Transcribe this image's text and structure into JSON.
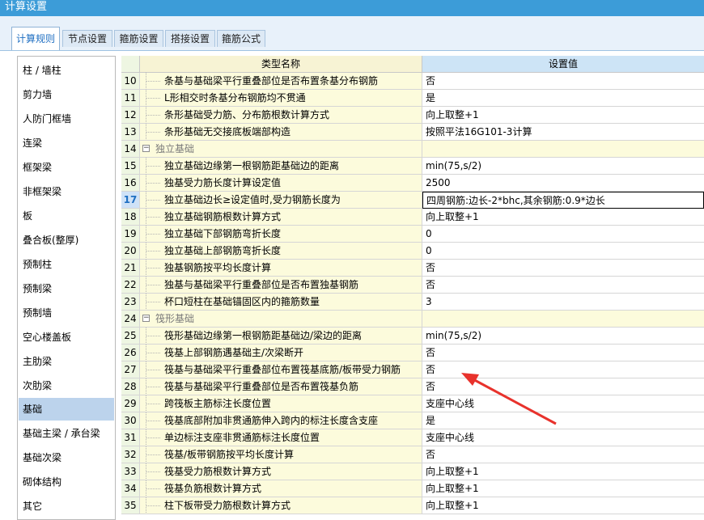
{
  "window": {
    "title": "计算设置"
  },
  "tabs": [
    "计算规则",
    "节点设置",
    "箍筋设置",
    "搭接设置",
    "箍筋公式"
  ],
  "sidebar": {
    "items": [
      "柱 / 墙柱",
      "剪力墙",
      "人防门框墙",
      "连梁",
      "框架梁",
      "非框架梁",
      "板",
      "叠合板(整厚)",
      "预制柱",
      "预制梁",
      "预制墙",
      "空心楼盖板",
      "主肋梁",
      "次肋梁",
      "基础",
      "基础主梁 / 承台梁",
      "基础次梁",
      "砌体结构",
      "其它"
    ],
    "selected": "基础"
  },
  "table": {
    "headers": {
      "name": "类型名称",
      "value": "设置值"
    },
    "rows": [
      {
        "num": "10",
        "name": "条基与基础梁平行重叠部位是否布置条基分布钢筋",
        "value": "否"
      },
      {
        "num": "11",
        "name": "L形相交时条基分布钢筋均不贯通",
        "value": "是"
      },
      {
        "num": "12",
        "name": "条形基础受力筋、分布筋根数计算方式",
        "value": "向上取整+1"
      },
      {
        "num": "13",
        "name": "条形基础无交接底板端部构造",
        "value": "按照平法16G101-3计算"
      },
      {
        "num": "14",
        "name": "独立基础",
        "value": "",
        "group": true
      },
      {
        "num": "15",
        "name": "独立基础边缘第一根钢筋距基础边的距离",
        "value": "min(75,s/2)"
      },
      {
        "num": "16",
        "name": "独基受力筋长度计算设定值",
        "value": "2500"
      },
      {
        "num": "17",
        "name": "独立基础边长≥设定值时,受力钢筋长度为",
        "value": "四周钢筋:边长-2*bhc,其余钢筋:0.9*边长",
        "active": true
      },
      {
        "num": "18",
        "name": "独立基础钢筋根数计算方式",
        "value": "向上取整+1"
      },
      {
        "num": "19",
        "name": "独立基础下部钢筋弯折长度",
        "value": "0"
      },
      {
        "num": "20",
        "name": "独立基础上部钢筋弯折长度",
        "value": "0"
      },
      {
        "num": "21",
        "name": "独基钢筋按平均长度计算",
        "value": "否"
      },
      {
        "num": "22",
        "name": "独基与基础梁平行重叠部位是否布置独基钢筋",
        "value": "否"
      },
      {
        "num": "23",
        "name": "杯口短柱在基础锚固区内的箍筋数量",
        "value": "3"
      },
      {
        "num": "24",
        "name": "筏形基础",
        "value": "",
        "group": true
      },
      {
        "num": "25",
        "name": "筏形基础边缘第一根钢筋距基础边/梁边的距离",
        "value": "min(75,s/2)"
      },
      {
        "num": "26",
        "name": "筏基上部钢筋遇基础主/次梁断开",
        "value": "否"
      },
      {
        "num": "27",
        "name": "筏基与基础梁平行重叠部位布置筏基底筋/板带受力钢筋",
        "value": "否"
      },
      {
        "num": "28",
        "name": "筏基与基础梁平行重叠部位是否布置筏基负筋",
        "value": "否"
      },
      {
        "num": "29",
        "name": "跨筏板主筋标注长度位置",
        "value": "支座中心线"
      },
      {
        "num": "30",
        "name": "筏基底部附加非贯通筋伸入跨内的标注长度含支座",
        "value": "是"
      },
      {
        "num": "31",
        "name": "单边标注支座非贯通筋标注长度位置",
        "value": "支座中心线"
      },
      {
        "num": "32",
        "name": "筏基/板带钢筋按平均长度计算",
        "value": "否"
      },
      {
        "num": "33",
        "name": "筏基受力筋根数计算方式",
        "value": "向上取整+1"
      },
      {
        "num": "34",
        "name": "筏基负筋根数计算方式",
        "value": "向上取整+1"
      },
      {
        "num": "35",
        "name": "柱下板带受力筋根数计算方式",
        "value": "向上取整+1"
      }
    ]
  },
  "colors": {
    "titlebar": "#3c9cd8",
    "arrow": "#e8322c",
    "selectedNav": "#bcd3ec"
  },
  "icons": {
    "group_toggle": "minus-icon"
  }
}
